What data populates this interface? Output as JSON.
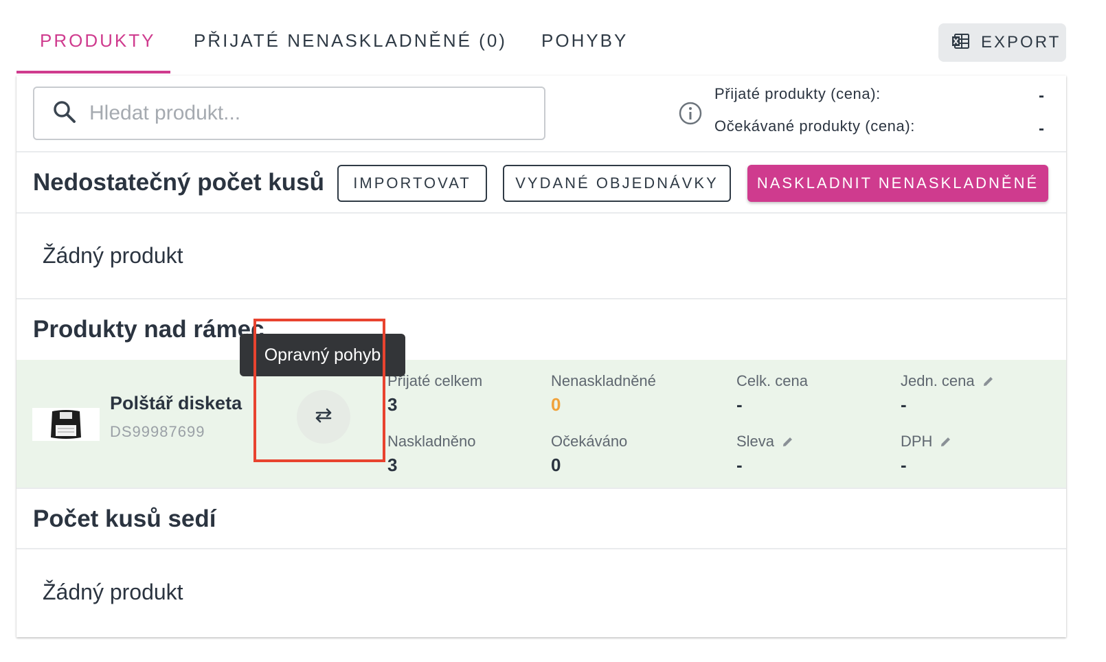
{
  "tabs": [
    {
      "label": "PRODUKTY",
      "active": true
    },
    {
      "label": "PŘIJATÉ NENASKLADNĚNÉ (0)",
      "active": false
    },
    {
      "label": "POHYBY",
      "active": false
    }
  ],
  "export_label": "EXPORT",
  "search": {
    "placeholder": "Hledat produkt..."
  },
  "summary": {
    "received_label": "Přijaté produkty (cena):",
    "received_value": "-",
    "expected_label": "Očekávané produkty (cena):",
    "expected_value": "-"
  },
  "insufficient": {
    "title": "Nedostatečný počet kusů",
    "import_label": "IMPORTOVAT",
    "orders_label": "VYDANÉ OBJEDNÁVKY",
    "stock_label": "NASKLADNIT NENASKLADNĚNÉ",
    "empty": "Žádný produkt"
  },
  "over": {
    "title": "Produkty nad rámec",
    "product": {
      "name": "Polštář disketa",
      "code": "DS99987699",
      "received_total_label": "Přijaté celkem",
      "received_total": "3",
      "unstocked_label": "Nenaskladněné",
      "unstocked": "0",
      "total_price_label": "Celk. cena",
      "total_price": "-",
      "unit_price_label": "Jedn. cena",
      "unit_price": "-",
      "stocked_label": "Naskladněno",
      "stocked": "3",
      "expected_label": "Očekáváno",
      "expected": "0",
      "discount_label": "Sleva",
      "discount": "-",
      "vat_label": "DPH",
      "vat": "-"
    }
  },
  "matching": {
    "title": "Počet kusů sedí",
    "empty": "Žádný produkt"
  },
  "tooltip": "Opravný pohyb",
  "colors": {
    "accent": "#cf3b8e",
    "warning": "#f0a23b",
    "row_bg": "#ebf4ea",
    "highlight": "#e8432f"
  }
}
